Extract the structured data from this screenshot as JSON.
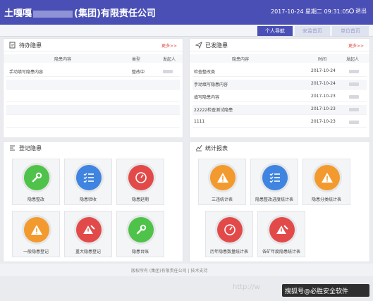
{
  "header": {
    "title_prefix": "土嘎嘎",
    "title_suffix": "(集团)有限责任公司",
    "datetime": "2017-10-24 星期二 09:31:05",
    "logout_label": "退出"
  },
  "tabs": [
    {
      "label": "个人导航",
      "active": true
    },
    {
      "label": "安监首页",
      "active": false
    },
    {
      "label": "单位首页",
      "active": false
    }
  ],
  "todo_panel": {
    "title": "待办隐患",
    "more": "更多>>",
    "columns": [
      "隐患内容",
      "类型",
      "发起人"
    ],
    "rows": [
      {
        "content": "手动填写隐患内容",
        "type": "整改中"
      }
    ]
  },
  "sent_panel": {
    "title": "已发隐患",
    "more": "更多>>",
    "columns": [
      "隐患内容",
      "时间",
      "发起人"
    ],
    "rows": [
      {
        "content": "检查整改类",
        "time": "2017-10-24"
      },
      {
        "content": "手动填写隐患内容",
        "time": "2017-10-24"
      },
      {
        "content": "填写隐患内容",
        "time": "2017-10-23"
      },
      {
        "content": "22222检查测试隐患",
        "time": "2017-10-23"
      },
      {
        "content": "1111",
        "time": "2017-10-23"
      }
    ]
  },
  "register_panel": {
    "title": "登记隐患",
    "tiles": [
      {
        "label": "隐患整改",
        "color": "green",
        "icon": "wrench-icon"
      },
      {
        "label": "隐患验收",
        "color": "blue",
        "icon": "checklist-icon"
      },
      {
        "label": "隐患延期",
        "color": "red",
        "icon": "clock-icon"
      },
      {
        "label": "一般隐患登记",
        "color": "orange",
        "icon": "warning-icon"
      },
      {
        "label": "重大隐患登记",
        "color": "red",
        "icon": "pencil-warning-icon"
      },
      {
        "label": "隐患台账",
        "color": "green",
        "icon": "wrench-icon"
      }
    ]
  },
  "stats_panel": {
    "title": "统计报表",
    "tiles": [
      {
        "label": "三违统计表",
        "color": "orange",
        "icon": "warning-icon"
      },
      {
        "label": "隐患整改进度统计表",
        "color": "blue",
        "icon": "checklist-icon"
      },
      {
        "label": "隐患分类统计表",
        "color": "orange",
        "icon": "warning-icon"
      },
      {
        "label": "历年隐患数量统计表",
        "color": "red",
        "icon": "clock-icon"
      },
      {
        "label": "各矿年度隐患统计表",
        "color": "red",
        "icon": "pencil-warning-icon"
      }
    ]
  },
  "footer": {
    "text": "版权所有 (集团)有限责任公司  |  技术支持"
  },
  "watermark": {
    "url": "http://w",
    "badge": "搜狐号@必胜安全软件"
  }
}
